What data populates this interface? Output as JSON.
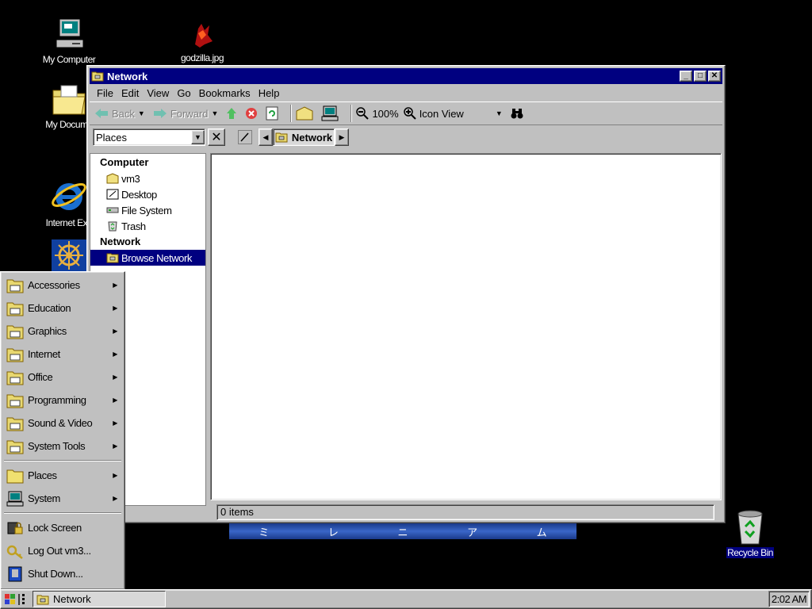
{
  "desktop": {
    "icons": {
      "my_computer": "My Computer",
      "godzilla": "godzilla.jpg",
      "my_documents": "My Docume",
      "internet": "Internet Exp",
      "recycle_bin": "Recycle Bin"
    },
    "banner_glyphs": [
      "ミ",
      "レ",
      "ニ",
      "ア",
      "ム"
    ]
  },
  "window": {
    "title": "Network",
    "controls": {
      "minimize": "_",
      "maximize": "□",
      "close": "✕"
    },
    "menu": [
      "File",
      "Edit",
      "View",
      "Go",
      "Bookmarks",
      "Help"
    ],
    "toolbar": {
      "back": "Back",
      "forward": "Forward",
      "zoom": "100%",
      "view_mode": "Icon View"
    },
    "location": {
      "places_combo": "Places",
      "path_button": "Network"
    },
    "sidebar": {
      "computer_heading": "Computer",
      "computer_items": [
        "vm3",
        "Desktop",
        "File System",
        "Trash"
      ],
      "network_heading": "Network",
      "network_items": [
        "Browse Network"
      ]
    },
    "status": "0 items"
  },
  "start_menu": {
    "groups": [
      "Accessories",
      "Education",
      "Graphics",
      "Internet",
      "Office",
      "Programming",
      "Sound & Video",
      "System Tools"
    ],
    "places": "Places",
    "system": "System",
    "lock": "Lock Screen",
    "logout": "Log Out vm3...",
    "shutdown": "Shut Down..."
  },
  "taskbar": {
    "task": "Network",
    "clock": "2:02 AM"
  },
  "colors": {
    "titlebar": "#000080",
    "face": "#c0c0c0",
    "desktop": "#000000",
    "selection": "#000080"
  }
}
